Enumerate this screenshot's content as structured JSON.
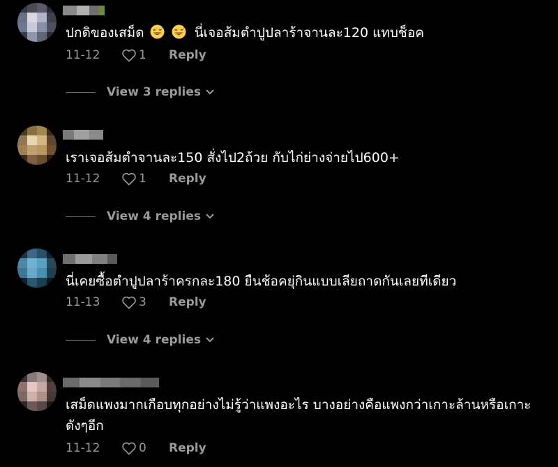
{
  "comments": [
    {
      "text_before": "ปกดิของเสม็ด",
      "emojis": [
        "grinning-sweat-face",
        "grinning-sweat-face"
      ],
      "text_after": "นี่เจอส้มตำปูปลาร้าจานละ120 แทบช็อค",
      "date": "11-12",
      "likes": "1",
      "reply_label": "Reply",
      "view_replies": "View 3 replies"
    },
    {
      "text": "เราเจอส้มตำจานละ150 สั่งไป2ถ้วย กับไก่ย่างจ่ายไป600+",
      "date": "11-12",
      "likes": "1",
      "reply_label": "Reply",
      "view_replies": "View 4 replies"
    },
    {
      "text": "นี่เคยซื้อตำปูปลาร้าครกละ180 ยืนช้อคยุ่กินแบบเลียถาดกันเลยทีเดียว",
      "date": "11-13",
      "likes": "3",
      "reply_label": "Reply",
      "view_replies": "View 4 replies"
    },
    {
      "text": "เสม็ดแพงมากเกือบทุกอย่างไม่รู้ว่าแพงอะไร บางอย่างคือแพงกว่าเกาะล้านหรือเกาะดังๆอีก",
      "date": "11-12",
      "likes": "0",
      "reply_label": "Reply"
    }
  ],
  "icons": {
    "like": "heart-outline-icon",
    "expand": "chevron-down-icon"
  },
  "colors": {
    "background": "#000000",
    "text": "#ffffff",
    "meta": "#9a9a9a"
  }
}
